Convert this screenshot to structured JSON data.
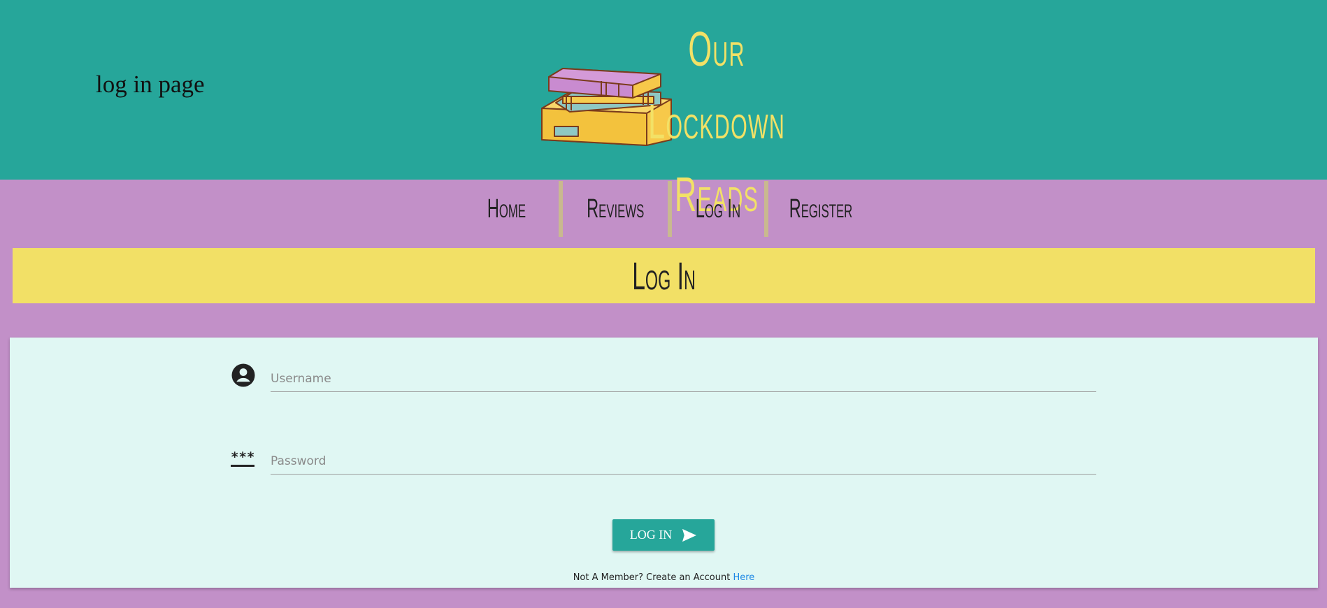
{
  "header": {
    "page_label": "log in page",
    "logo_title_line1": "Our Lockdown",
    "logo_title_line2": "Reads",
    "logo_icon": "books-stack-icon"
  },
  "nav": {
    "items": [
      {
        "label": "Home"
      },
      {
        "label": "Reviews"
      },
      {
        "label": "Log In"
      },
      {
        "label": "Register"
      }
    ]
  },
  "page": {
    "title": "Log In"
  },
  "form": {
    "username_placeholder": "Username",
    "username_icon": "account-circle-icon",
    "password_placeholder": "Password",
    "password_icon": "password-icon",
    "password_icon_glyph": "***",
    "submit_label": "LOG IN",
    "submit_icon": "send-icon",
    "footer_text": "Not A Member? Create an Account",
    "footer_link": "Here"
  },
  "colors": {
    "header_bg": "#26a69a",
    "page_bg": "#c290c8",
    "title_bar_bg": "#f2e066",
    "logo_text": "#f2e166",
    "card_bg": "#e0f7f3",
    "button_bg": "#26a69a",
    "link": "#1e88e5"
  }
}
